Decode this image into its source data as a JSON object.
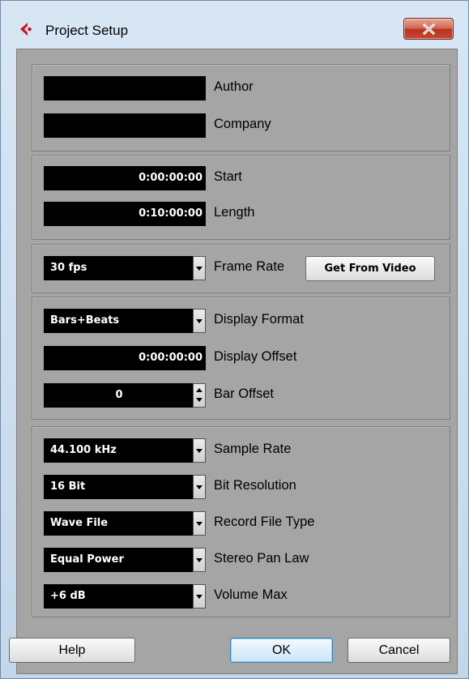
{
  "window": {
    "title": "Project Setup",
    "app_icon": "cubase-logo-icon",
    "close_icon": "close-x-icon"
  },
  "info": {
    "author": {
      "value": "",
      "label": "Author"
    },
    "company": {
      "value": "",
      "label": "Company"
    }
  },
  "time": {
    "start": {
      "value": "0:00:00:00",
      "label": "Start"
    },
    "length": {
      "value": "0:10:00:00",
      "label": "Length"
    }
  },
  "frame": {
    "value": "30 fps",
    "label": "Frame Rate",
    "button": "Get From Video"
  },
  "display": {
    "format": {
      "value": "Bars+Beats",
      "label": "Display Format"
    },
    "offset": {
      "value": "0:00:00:00",
      "label": "Display Offset"
    },
    "bar_offset": {
      "value": "0",
      "label": "Bar Offset"
    }
  },
  "audio": {
    "sample_rate": {
      "value": "44.100 kHz",
      "label": "Sample Rate"
    },
    "bit_resolution": {
      "value": "16 Bit",
      "label": "Bit Resolution"
    },
    "record_file_type": {
      "value": "Wave File",
      "label": "Record File Type"
    },
    "stereo_pan_law": {
      "value": "Equal Power",
      "label": "Stereo Pan Law"
    },
    "volume_max": {
      "value": "+6 dB",
      "label": "Volume Max"
    }
  },
  "buttons": {
    "help": "Help",
    "ok": "OK",
    "cancel": "Cancel"
  },
  "colors": {
    "panel": "#a5a5a5",
    "field": "#000000",
    "close_button": "#c54a36",
    "ok_focus": "#3c7fb1"
  }
}
